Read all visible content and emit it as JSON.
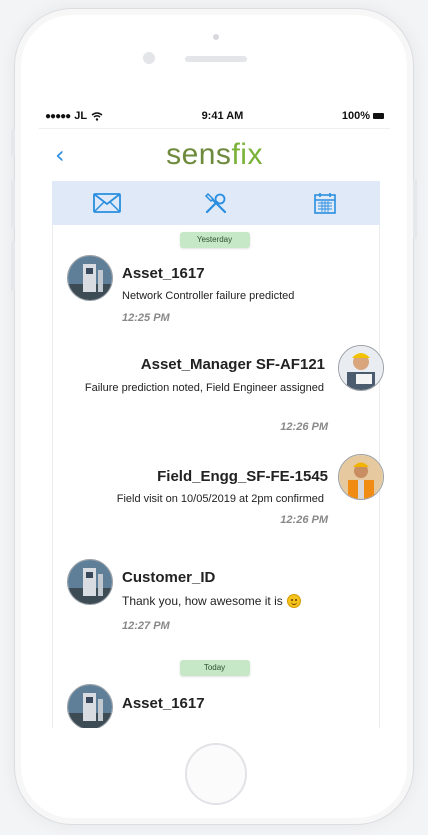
{
  "status_bar": {
    "carrier": "JL",
    "time": "9:41 AM",
    "battery": "100%"
  },
  "header": {
    "back_icon": "chevron-left-icon",
    "logo_part1": "sens",
    "logo_part2": "fix"
  },
  "colors": {
    "accent_blue": "#2a8ee0",
    "logo_green": "#6e8a3c",
    "toolbar_bg": "#dfe9f8",
    "pill_green": "#c6e8c6"
  },
  "toolbar": {
    "icons": [
      "mail-icon",
      "tools-icon",
      "calendar-icon"
    ]
  },
  "chat": {
    "divider_yesterday": "Yesterday",
    "divider_today": "Today",
    "messages": [
      {
        "name": "Asset_1617",
        "text": "Network Controller failure predicted",
        "time": "12:25 PM",
        "side": "left"
      },
      {
        "name": "Asset_Manager SF-AF121",
        "text": "Failure prediction noted, Field Engineer assigned",
        "time": "12:26 PM",
        "side": "right"
      },
      {
        "name": "Field_Engg_SF-FE-1545",
        "text": "Field visit on 10/05/2019 at 2pm confirmed",
        "time": "12:26 PM",
        "side": "right"
      },
      {
        "name": "Customer_ID",
        "text": "Thank you, how awesome it is",
        "time": "12:27 PM",
        "side": "left"
      },
      {
        "name": "Asset_1617",
        "text": "",
        "time": "",
        "side": "left"
      }
    ]
  }
}
